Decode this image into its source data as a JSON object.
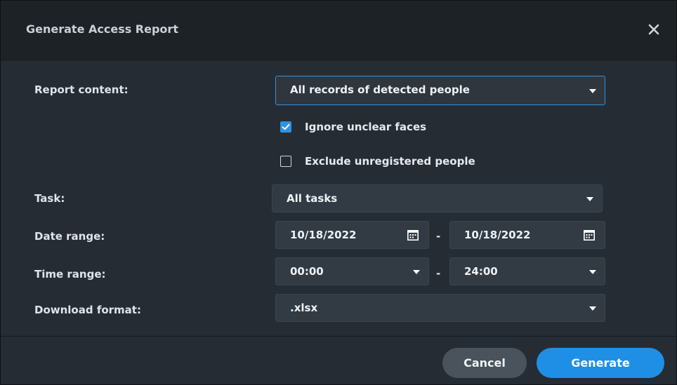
{
  "dialog": {
    "title": "Generate Access Report",
    "close_icon": "close-icon"
  },
  "form": {
    "report_content": {
      "label": "Report content:",
      "value": "All records of detected people"
    },
    "ignore_unclear_faces": {
      "label": "Ignore unclear faces",
      "checked": true
    },
    "exclude_unregistered": {
      "label": "Exclude unregistered people",
      "checked": false
    },
    "task": {
      "label": "Task:",
      "value": "All tasks"
    },
    "date_range": {
      "label": "Date range:",
      "start": "10/18/2022",
      "end": "10/18/2022",
      "separator": "-"
    },
    "time_range": {
      "label": "Time range:",
      "start": "00:00",
      "end": "24:00",
      "separator": "-"
    },
    "download_format": {
      "label": "Download format:",
      "value": ".xlsx"
    }
  },
  "footer": {
    "cancel_label": "Cancel",
    "generate_label": "Generate"
  },
  "colors": {
    "accent": "#1f8fe6",
    "dialog_bg": "#262c33",
    "titlebar_bg": "#1d2227",
    "field_bg": "#323a43"
  }
}
